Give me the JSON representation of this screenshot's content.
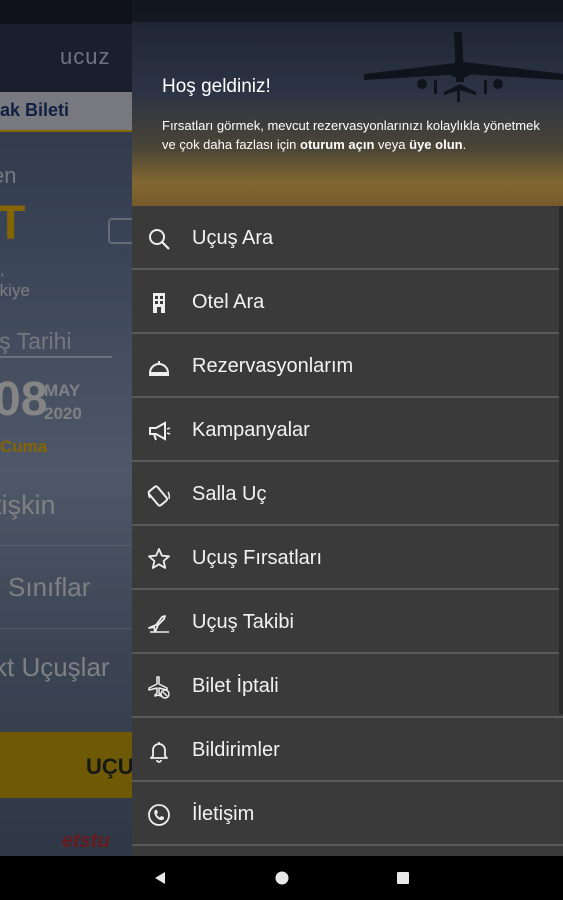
{
  "app": {
    "logo": "ucuz",
    "tab_label": "ak Bileti",
    "from_label": "en",
    "airport_code": "T",
    "country_comma": ",",
    "country": "rkiye",
    "date_label": "iş Tarihi",
    "day": "08",
    "month": "MAY",
    "year": "2020",
    "weekday": "Cuma",
    "passenger": "tişkin",
    "cabin_class": "Sınıflar",
    "direct": "kt Uçuşlar",
    "search_button": "UÇU",
    "footer_logo": "etstu"
  },
  "drawer": {
    "welcome_title": "Hoş geldiniz!",
    "welcome_text_part1": "Fırsatları görmek, mevcut rezervasyonlarınızı kolaylıkla yönetmek ve çok daha fazlası için ",
    "welcome_link_login": "oturum açın",
    "welcome_text_part2": " veya ",
    "welcome_link_register": "üye olun",
    "welcome_text_part3": ".",
    "menu": [
      {
        "label": "Uçuş Ara",
        "icon": "search-icon"
      },
      {
        "label": "Otel Ara",
        "icon": "building-icon"
      },
      {
        "label": "Rezervasyonlarım",
        "icon": "service-bell-icon"
      },
      {
        "label": "Kampanyalar",
        "icon": "megaphone-icon"
      },
      {
        "label": "Salla Uç",
        "icon": "shake-phone-icon"
      },
      {
        "label": "Uçuş Fırsatları",
        "icon": "star-icon"
      },
      {
        "label": "Uçuş Takibi",
        "icon": "plane-icon"
      },
      {
        "label": "Bilet İptali",
        "icon": "plane-cancel-icon"
      },
      {
        "label": "Bildirimler",
        "icon": "bell-icon"
      },
      {
        "label": "İletişim",
        "icon": "phone-icon"
      }
    ]
  },
  "colors": {
    "accent_yellow": "#f2b705",
    "drawer_bg": "#3a3a3a",
    "divider": "#5a5a5a"
  }
}
